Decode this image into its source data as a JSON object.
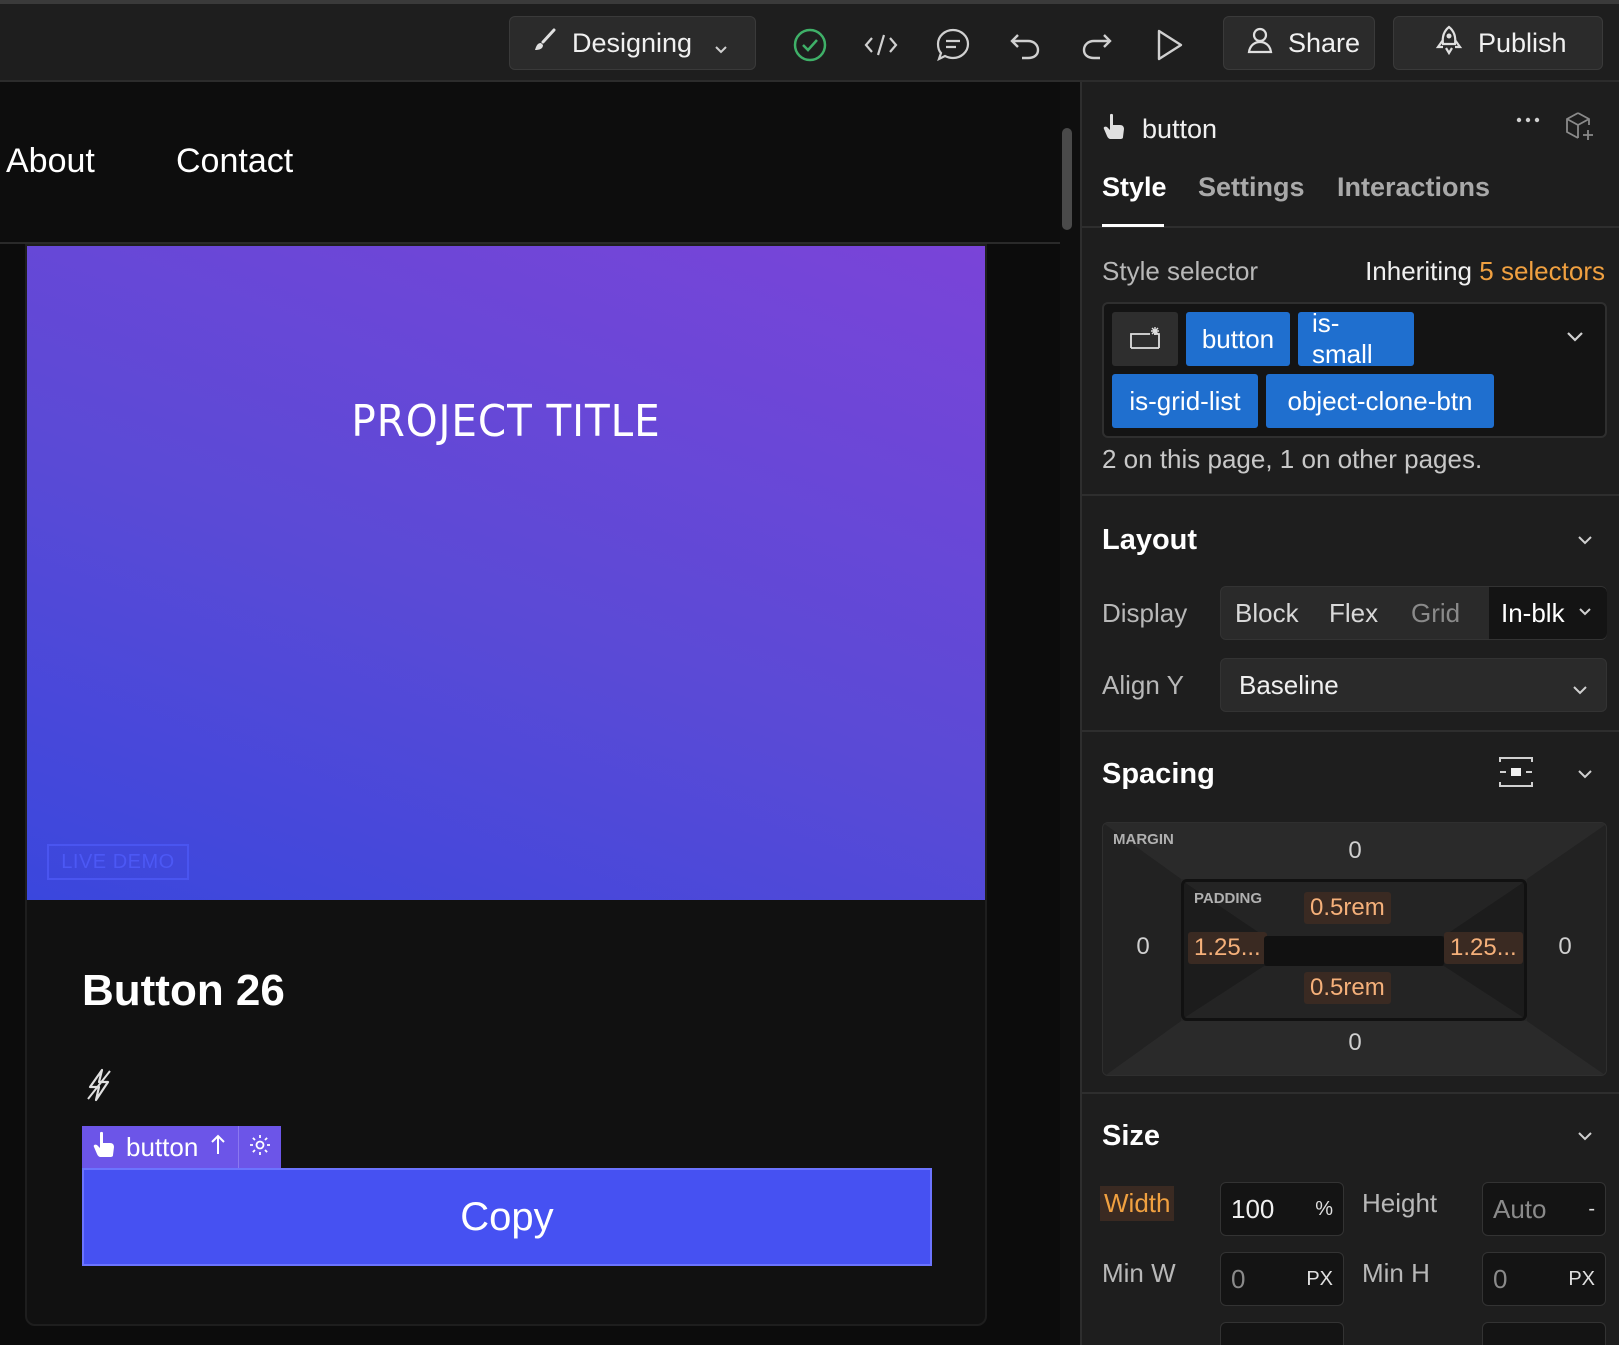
{
  "toolbar": {
    "mode_label": "Designing",
    "share_label": "Share",
    "publish_label": "Publish",
    "icons": [
      "brush-icon",
      "check-circle-icon",
      "code-icon",
      "comment-icon",
      "undo-icon",
      "redo-icon",
      "play-icon",
      "user-icon",
      "rocket-icon"
    ]
  },
  "canvas": {
    "nav": {
      "about": "About",
      "contact": "Contact"
    },
    "hero": {
      "title": "PROJECT TITLE",
      "live_demo": "LIVE DEMO"
    },
    "card_title": "Button 26",
    "selected_tag": {
      "label": "button"
    },
    "copy_button": "Copy"
  },
  "panel": {
    "element_name": "button",
    "tabs": [
      {
        "label": "Style",
        "active": true
      },
      {
        "label": "Settings",
        "active": false
      },
      {
        "label": "Interactions",
        "active": false
      }
    ],
    "style_selector": {
      "label": "Style selector",
      "inheriting_prefix": "Inheriting",
      "inheriting_count": "5 selectors",
      "chips": [
        "button",
        "is-small",
        "is-grid-list",
        "object-clone-btn"
      ],
      "note": "2 on this page, 1 on other pages."
    },
    "layout": {
      "title": "Layout",
      "display_label": "Display",
      "display_options": [
        "Block",
        "Flex",
        "Grid",
        "In-blk"
      ],
      "display_selected": "In-blk",
      "align_label": "Align Y",
      "align_value": "Baseline"
    },
    "spacing": {
      "title": "Spacing",
      "margin_label": "MARGIN",
      "padding_label": "PADDING",
      "margin": {
        "top": "0",
        "right": "0",
        "bottom": "0",
        "left": "0"
      },
      "padding": {
        "top": "0.5rem",
        "right": "1.25...",
        "bottom": "0.5rem",
        "left": "1.25..."
      }
    },
    "size": {
      "title": "Size",
      "width_label": "Width",
      "width_value": "100",
      "width_unit": "%",
      "height_label": "Height",
      "height_value": "Auto",
      "height_unit": "-",
      "minw_label": "Min W",
      "minw_value": "0",
      "minw_unit": "PX",
      "minh_label": "Min H",
      "minh_value": "0",
      "minh_unit": "PX"
    }
  },
  "colors": {
    "accent_blue": "#1f6fcf",
    "button_blue": "#4651f2",
    "orange": "#f0a040",
    "selection_purple": "#6c55e8"
  }
}
